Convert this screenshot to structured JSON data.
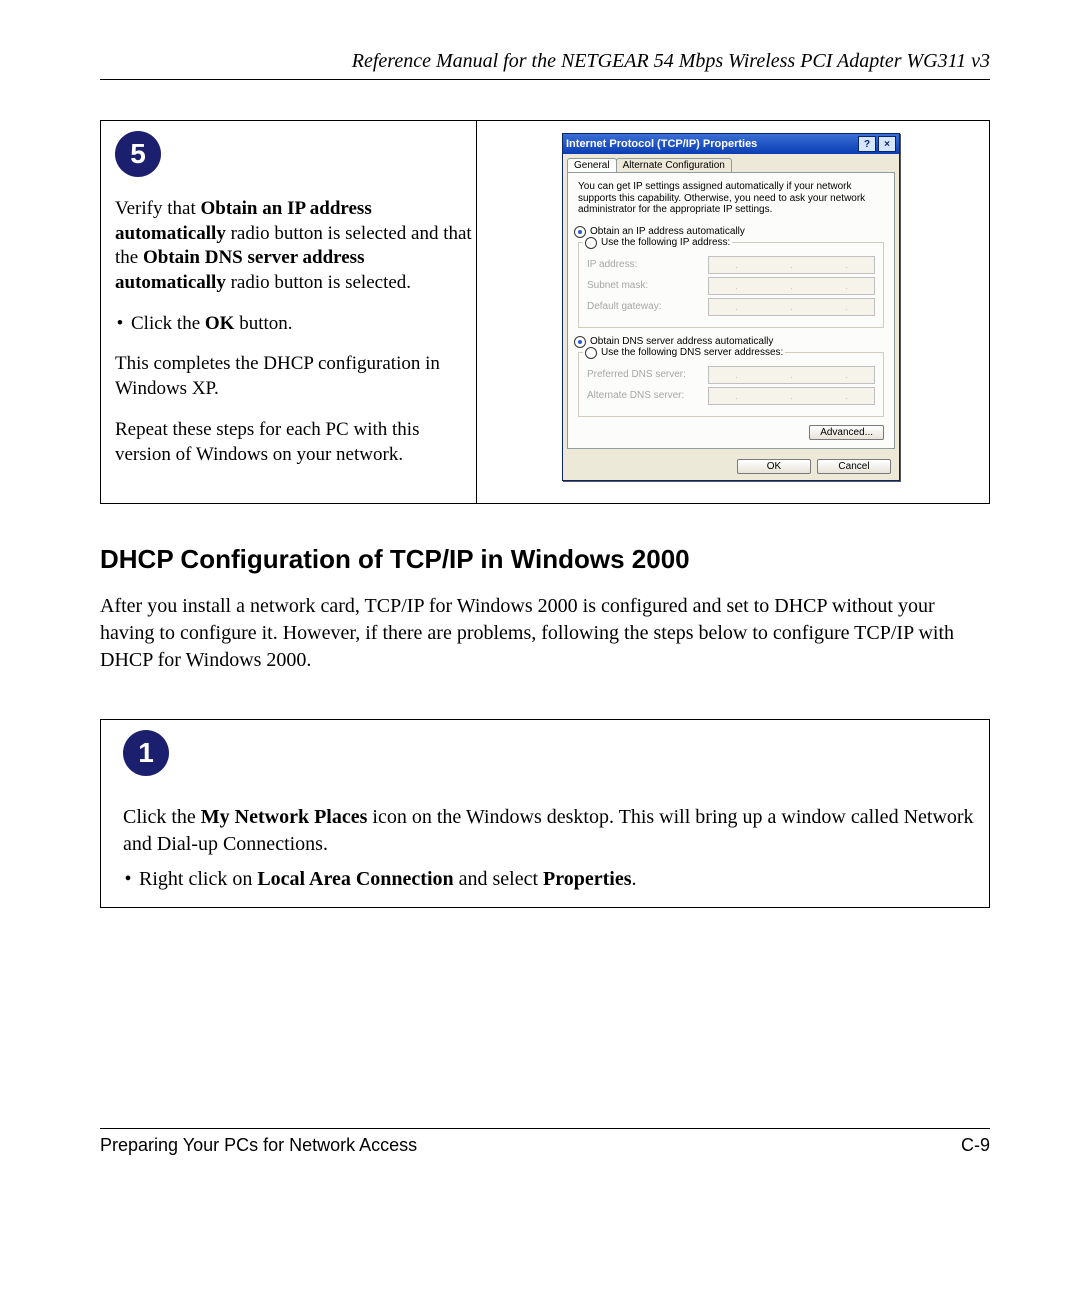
{
  "header": {
    "title": "Reference Manual for the NETGEAR 54 Mbps Wireless PCI Adapter WG311 v3"
  },
  "step5": {
    "badge": "5",
    "p1_a": "Verify that ",
    "p1_b": "Obtain an IP address automatically",
    "p1_c": " radio button is selected and that the ",
    "p1_d": "Obtain DNS server address automatically",
    "p1_e": " radio button is selected.",
    "bullet_a": "Click the ",
    "bullet_b": "OK",
    "bullet_c": " button.",
    "p2": "This completes the DHCP configuration in Windows XP.",
    "p3": "Repeat these steps for each PC with this version of Windows on your network."
  },
  "dialog": {
    "title": "Internet Protocol (TCP/IP) Properties",
    "help": "?",
    "close": "×",
    "tabs": {
      "general": "General",
      "alt": "Alternate Configuration"
    },
    "intro": "You can get IP settings assigned automatically if your network supports this capability. Otherwise, you need to ask your network administrator for the appropriate IP settings.",
    "radio_ip_auto": "Obtain an IP address automatically",
    "radio_ip_manual": "Use the following IP address:",
    "lbl_ip": "IP address:",
    "lbl_subnet": "Subnet mask:",
    "lbl_gateway": "Default gateway:",
    "radio_dns_auto": "Obtain DNS server address automatically",
    "radio_dns_manual": "Use the following DNS server addresses:",
    "lbl_pref_dns": "Preferred DNS server:",
    "lbl_alt_dns": "Alternate DNS server:",
    "btn_advanced": "Advanced...",
    "btn_ok": "OK",
    "btn_cancel": "Cancel"
  },
  "section_heading": "DHCP Configuration of TCP/IP in Windows 2000",
  "section_para": "After you install a network card, TCP/IP for Windows 2000 is configured and set to DHCP without your having to configure it.  However, if there are problems, following the steps below to configure TCP/IP with DHCP for Windows 2000.",
  "step1": {
    "badge": "1",
    "p1_a": "Click the ",
    "p1_b": "My Network Places",
    "p1_c": " icon on the Windows desktop. This will bring up a window called Network and Dial-up Connections.",
    "bullet_a": "Right click on ",
    "bullet_b": "Local Area Connection",
    "bullet_c": " and select ",
    "bullet_d": "Properties",
    "bullet_e": "."
  },
  "footer": {
    "left": "Preparing Your PCs for Network Access",
    "right": "C-9"
  }
}
